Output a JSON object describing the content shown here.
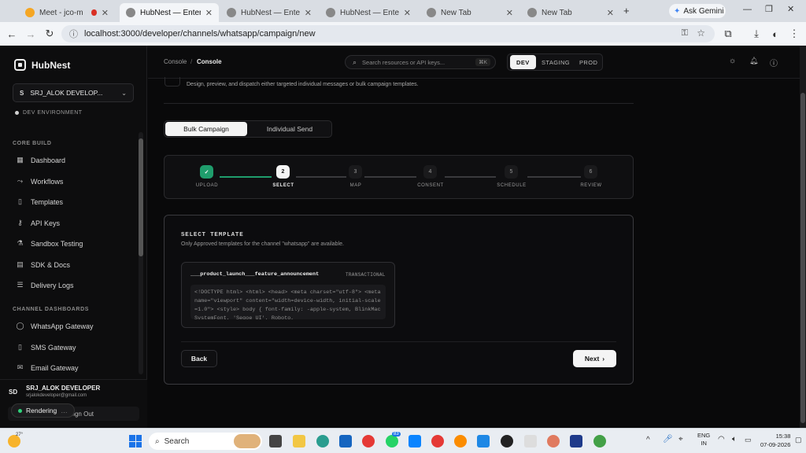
{
  "browser": {
    "tabs": [
      {
        "label": "Meet - jco-mnce",
        "active": false
      },
      {
        "label": "HubNest — Enterprise",
        "active": true
      },
      {
        "label": "HubNest — Enterprise",
        "active": false
      },
      {
        "label": "HubNest — Enterprise",
        "active": false
      },
      {
        "label": "New Tab",
        "active": false
      },
      {
        "label": "New Tab",
        "active": false
      }
    ],
    "ask_gemini": "Ask Gemini",
    "url": "localhost:3000/developer/channels/whatsapp/campaign/new"
  },
  "sidebar": {
    "brand": "HubNest",
    "workspace_initial": "S",
    "workspace_name": "SRJ_ALOK DEVELOP...",
    "env_label": "DEV ENVIRONMENT",
    "core_label": "CORE BUILD",
    "core_items": [
      "Dashboard",
      "Workflows",
      "Templates",
      "API Keys",
      "Sandbox Testing",
      "SDK & Docs",
      "Delivery Logs"
    ],
    "channel_label": "CHANNEL DASHBOARDS",
    "channel_items": [
      "WhatsApp Gateway",
      "SMS Gateway",
      "Email Gateway"
    ],
    "user_initials": "SD",
    "user_name": "SRJ_ALOK DEVELOPER",
    "user_email": "srjalokdeveloper@gmail.com",
    "rendering": "Rendering",
    "signout": "Sign Out"
  },
  "topbar": {
    "crumb_root": "Console",
    "crumb_sep": "/",
    "crumb_current": "Console",
    "search_placeholder": "Search resources or API keys...",
    "search_shortcut": "⌘K",
    "envs": [
      "DEV",
      "STAGING",
      "PROD"
    ]
  },
  "page": {
    "subtitle": "Design, preview, and dispatch either targeted individual messages or bulk campaign templates.",
    "mode_tabs": [
      "Bulk Campaign",
      "Individual Send"
    ],
    "steps": [
      {
        "num": "✓",
        "label": "UPLOAD"
      },
      {
        "num": "2",
        "label": "SELECT"
      },
      {
        "num": "3",
        "label": "MAP"
      },
      {
        "num": "4",
        "label": "CONSENT"
      },
      {
        "num": "5",
        "label": "SCHEDULE"
      },
      {
        "num": "6",
        "label": "REVIEW"
      }
    ],
    "select_heading": "SELECT TEMPLATE",
    "select_note": "Only Approved templates for the channel \"whatsapp\" are available.",
    "template_name": "___product_launch___feature_announcement",
    "template_category": "TRANSACTIONAL",
    "template_preview": "<!DOCTYPE html> <html> <head> <meta charset=\"utf-8\"> <meta name=\"viewport\" content=\"width=device-width, initial-scale=1.0\"> <style> body { font-family: -apple-system, BlinkMacSystemFont, 'Segoe UI', Roboto,",
    "back": "Back",
    "next": "Next"
  },
  "taskbar": {
    "search": "Search",
    "lang_top": "ENG",
    "lang_bottom": "IN",
    "time": "15:38",
    "date": "07-09-2026",
    "weather": "27°",
    "badge": "83"
  },
  "colors": {
    "accent_green": "#1f9d6c",
    "bg": "#09090a"
  }
}
